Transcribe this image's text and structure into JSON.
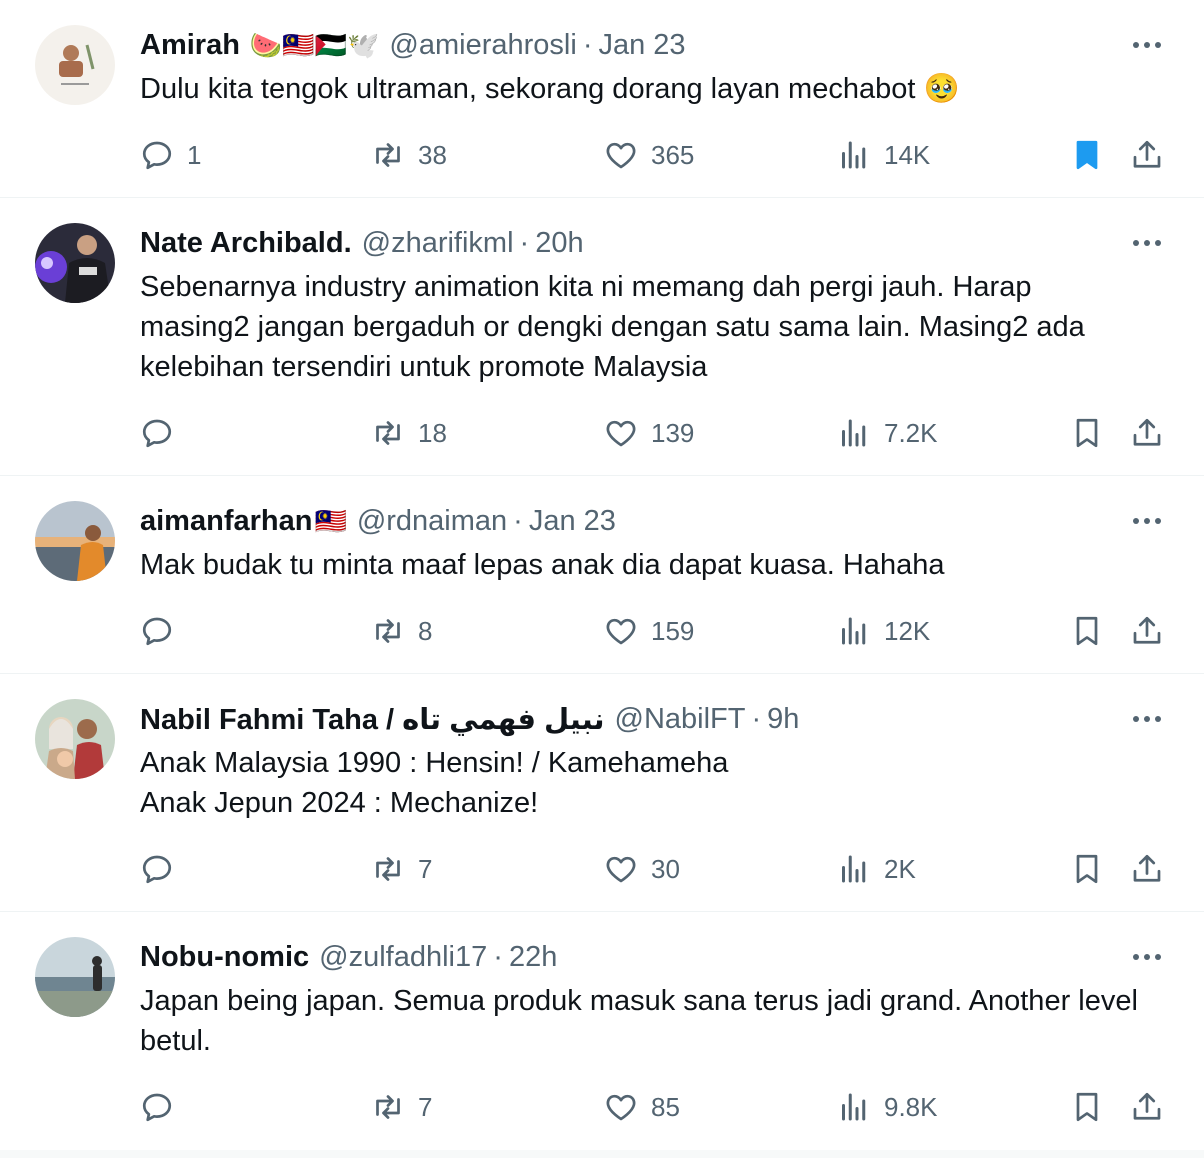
{
  "tweets": [
    {
      "name": "Amirah",
      "emojis": "🍉🇲🇾🇵🇸🕊️",
      "handle": "@amierahrosli",
      "time": "Jan 23",
      "text": "Dulu kita tengok ultraman, sekorang dorang layan mechabot 🥹",
      "replies": "1",
      "retweets": "38",
      "likes": "365",
      "views": "14K",
      "bookmarked": true
    },
    {
      "name": "Nate Archibald.",
      "emojis": "",
      "handle": "@zharifikml",
      "time": "20h",
      "text": "Sebenarnya industry animation kita ni memang dah pergi jauh. Harap masing2 jangan bergaduh or dengki dengan satu sama lain. Masing2 ada kelebihan tersendiri untuk promote Malaysia",
      "replies": "",
      "retweets": "18",
      "likes": "139",
      "views": "7.2K",
      "bookmarked": false
    },
    {
      "name": "aimanfarhan",
      "emojis": "🇲🇾",
      "handle": "@rdnaiman",
      "time": "Jan 23",
      "text": "Mak budak tu minta maaf lepas anak dia dapat kuasa. Hahaha",
      "replies": "",
      "retweets": "8",
      "likes": "159",
      "views": "12K",
      "bookmarked": false
    },
    {
      "name": "Nabil Fahmi Taha / نبيل فهمي تاه",
      "emojis": "",
      "handle": "@NabilFT",
      "time": "9h",
      "text": "Anak Malaysia 1990 : Hensin! / Kamehameha\nAnak Jepun 2024 : Mechanize!",
      "replies": "",
      "retweets": "7",
      "likes": "30",
      "views": "2K",
      "bookmarked": false
    },
    {
      "name": "Nobu-nomic",
      "emojis": "",
      "handle": "@zulfadhli17",
      "time": "22h",
      "text": "Japan being japan. Semua produk masuk sana terus jadi grand. Another level betul.",
      "replies": "",
      "retweets": "7",
      "likes": "85",
      "views": "9.8K",
      "bookmarked": false
    }
  ],
  "separator": "·",
  "colors": {
    "text": "#0f1419",
    "secondary": "#536471",
    "bookmark_active": "#1d9bf0",
    "divider": "#eff3f4"
  },
  "icons": [
    "reply-icon",
    "retweet-icon",
    "like-icon",
    "views-icon",
    "bookmark-icon",
    "share-icon",
    "more-icon"
  ]
}
